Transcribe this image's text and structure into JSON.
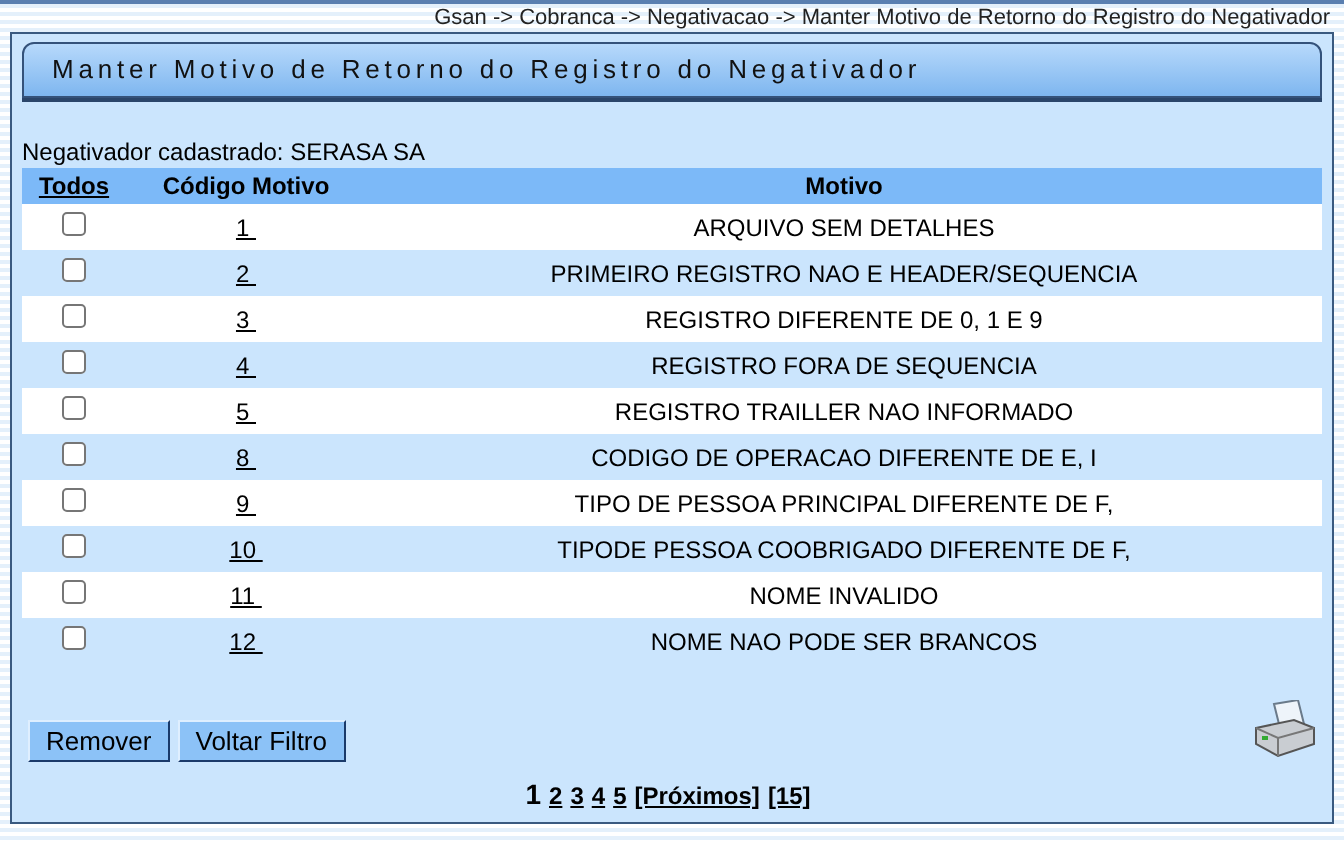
{
  "breadcrumb": "Gsan -> Cobranca -> Negativacao -> Manter Motivo de Retorno do Registro do Negativador",
  "title": "Manter Motivo de Retorno do Registro do Negativador",
  "negativador": "Negativador cadastrado: SERASA SA",
  "table": {
    "columns": [
      "Todos",
      "Código Motivo",
      "Motivo"
    ],
    "rows": [
      {
        "checked": false,
        "code": "1",
        "motivo": "ARQUIVO SEM DETALHES"
      },
      {
        "checked": false,
        "code": "2",
        "motivo": "PRIMEIRO REGISTRO NAO E HEADER/SEQUENCIA"
      },
      {
        "checked": false,
        "code": "3",
        "motivo": "REGISTRO DIFERENTE DE 0, 1 E 9"
      },
      {
        "checked": false,
        "code": "4",
        "motivo": "REGISTRO FORA DE SEQUENCIA"
      },
      {
        "checked": false,
        "code": "5",
        "motivo": "REGISTRO TRAILLER NAO INFORMADO"
      },
      {
        "checked": false,
        "code": "8",
        "motivo": "CODIGO DE OPERACAO DIFERENTE DE E, I"
      },
      {
        "checked": false,
        "code": "9",
        "motivo": "TIPO DE PESSOA PRINCIPAL DIFERENTE DE F,"
      },
      {
        "checked": false,
        "code": "10",
        "motivo": "TIPODE PESSOA COOBRIGADO DIFERENTE DE F,"
      },
      {
        "checked": false,
        "code": "11",
        "motivo": "NOME INVALIDO"
      },
      {
        "checked": false,
        "code": "12",
        "motivo": "NOME NAO PODE SER BRANCOS"
      }
    ]
  },
  "buttons": [
    "Remover",
    "Voltar Filtro"
  ],
  "pagination": [
    {
      "label": "1",
      "selected": true
    },
    {
      "label": "2",
      "selected": false
    },
    {
      "label": "3",
      "selected": false
    },
    {
      "label": "4",
      "selected": false
    },
    {
      "label": "5",
      "selected": false
    },
    {
      "label": "[Próximos]",
      "selected": false
    },
    {
      "label": "[15]",
      "selected": false
    }
  ]
}
